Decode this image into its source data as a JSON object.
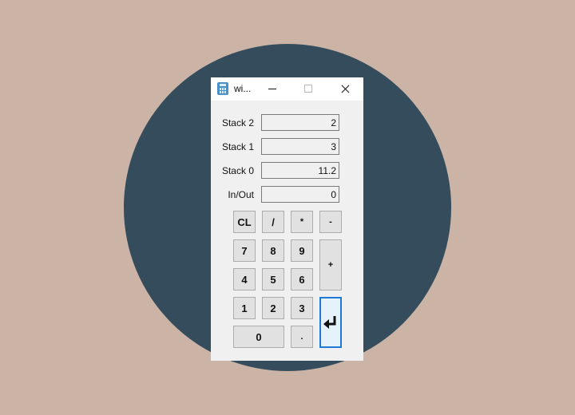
{
  "window": {
    "title": "wi...",
    "app_icon": "calculator-icon"
  },
  "titlebar_buttons": {
    "minimize_icon": "minimize-icon",
    "maximize_icon": "maximize-icon",
    "close_icon": "close-icon"
  },
  "stack": {
    "stack2": {
      "label": "Stack 2",
      "value": "2"
    },
    "stack1": {
      "label": "Stack 1",
      "value": "3"
    },
    "stack0": {
      "label": "Stack 0",
      "value": "11.2"
    },
    "inout": {
      "label": "In/Out",
      "value": "0"
    }
  },
  "keys": {
    "clear": "CL",
    "divide": "/",
    "multiply": "*",
    "subtract": "-",
    "add": "+",
    "seven": "7",
    "eight": "8",
    "nine": "9",
    "four": "4",
    "five": "5",
    "six": "6",
    "one": "1",
    "two": "2",
    "three": "3",
    "zero": "0",
    "decimal": ".",
    "enter_icon": "enter-return-icon"
  },
  "colors": {
    "background": "#cbb3a5",
    "disc": "#344c5c",
    "focus_accent": "#1e7ad7"
  }
}
